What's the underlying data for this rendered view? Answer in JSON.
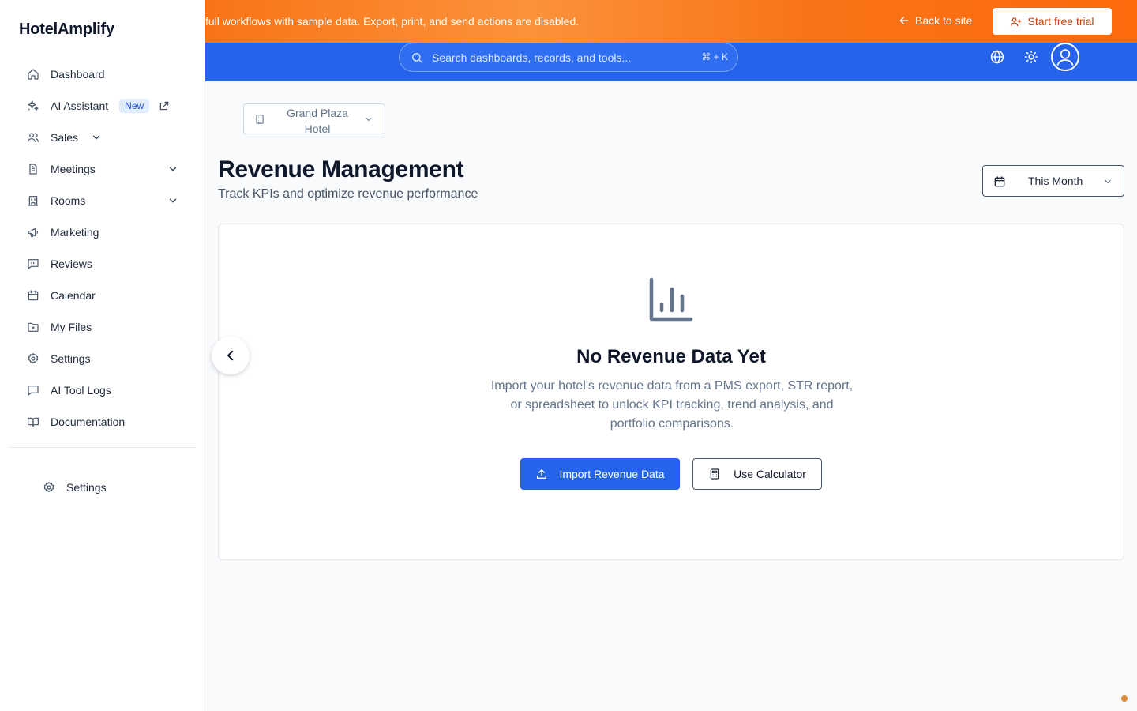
{
  "sidebar": {
    "brand": "HotelAmplify",
    "items": [
      {
        "label": "Dashboard",
        "icon": "home-icon"
      },
      {
        "label": "AI Assistant",
        "icon": "sparkles-icon",
        "badge": "New",
        "external": true
      },
      {
        "label": "Sales",
        "icon": "users-icon",
        "chevron": "near"
      },
      {
        "label": "Meetings",
        "icon": "document-icon",
        "chevron": "far"
      },
      {
        "label": "Rooms",
        "icon": "building-icon",
        "chevron": "far"
      },
      {
        "label": "Marketing",
        "icon": "megaphone-icon"
      },
      {
        "label": "Reviews",
        "icon": "chat-quote-icon"
      },
      {
        "label": "Calendar",
        "icon": "calendar-icon"
      },
      {
        "label": "My Files",
        "icon": "folder-icon"
      },
      {
        "label": "Settings",
        "icon": "gear-icon"
      },
      {
        "label": "AI Tool Logs",
        "icon": "message-icon"
      },
      {
        "label": "Documentation",
        "icon": "book-icon"
      }
    ],
    "bottom_settings_label": "Settings"
  },
  "banner": {
    "text": "full workflows with sample data. Export, print, and send actions are disabled.",
    "back_label": "Back to site",
    "trial_label": "Start free trial"
  },
  "topbar": {
    "search_placeholder": "Search dashboards, records, and tools...",
    "shortcut": "⌘ + K"
  },
  "main": {
    "hotel_selector": "Grand Plaza Hotel",
    "title": "Revenue Management",
    "subtitle": "Track KPIs and optimize revenue performance",
    "date_range": "This Month",
    "empty_state": {
      "title": "No Revenue Data Yet",
      "description": "Import your hotel's revenue data from a PMS export, STR report, or spreadsheet to unlock KPI tracking, trend analysis, and portfolio comparisons.",
      "primary_button": "Import Revenue Data",
      "secondary_button": "Use Calculator"
    }
  },
  "colors": {
    "accent": "#2563eb",
    "banner": "#f97316",
    "trial_text": "#c2410c"
  }
}
